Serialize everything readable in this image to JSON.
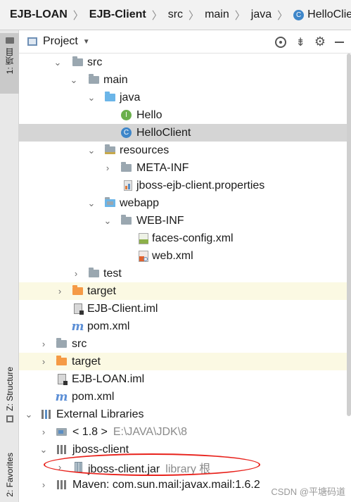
{
  "breadcrumb": [
    "EJB-LOAN",
    "EJB-Client",
    "src",
    "main",
    "java",
    "HelloClient"
  ],
  "left_tabs": {
    "project": "1: 项目",
    "structure": "Z: Structure",
    "favorites": "2: Favorites"
  },
  "panel": {
    "title": "Project"
  },
  "tree": [
    {
      "label": "src",
      "icon": "folder-icon"
    },
    {
      "label": "main",
      "icon": "folder-icon"
    },
    {
      "label": "java",
      "icon": "source-folder-icon"
    },
    {
      "label": "Hello",
      "icon": "interface-icon"
    },
    {
      "label": "HelloClient",
      "icon": "class-icon"
    },
    {
      "label": "resources",
      "icon": "resources-folder-icon"
    },
    {
      "label": "META-INF",
      "icon": "folder-icon"
    },
    {
      "label": "jboss-ejb-client.properties",
      "icon": "properties-file-icon"
    },
    {
      "label": "webapp",
      "icon": "web-folder-icon"
    },
    {
      "label": "WEB-INF",
      "icon": "folder-icon"
    },
    {
      "label": "faces-config.xml",
      "icon": "jsf-file-icon"
    },
    {
      "label": "web.xml",
      "icon": "web-xml-icon"
    },
    {
      "label": "test",
      "icon": "folder-icon"
    },
    {
      "label": "target",
      "icon": "excluded-folder-icon"
    },
    {
      "label": "EJB-Client.iml",
      "icon": "iml-file-icon"
    },
    {
      "label": "pom.xml",
      "icon": "maven-icon"
    },
    {
      "label": "src",
      "icon": "folder-icon"
    },
    {
      "label": "target",
      "icon": "excluded-folder-icon"
    },
    {
      "label": "EJB-LOAN.iml",
      "icon": "iml-file-icon"
    },
    {
      "label": "pom.xml",
      "icon": "maven-icon"
    },
    {
      "label": "External Libraries",
      "icon": "libraries-icon"
    },
    {
      "label": "< 1.8 >",
      "hint": "E:\\JAVA\\JDK\\8",
      "icon": "jdk-icon"
    },
    {
      "label": "jboss-client",
      "icon": "library-icon"
    },
    {
      "label": "jboss-client.jar",
      "hint": "library 根",
      "icon": "jar-icon"
    },
    {
      "label": "Maven: com.sun.mail:javax.mail:1.6.2",
      "icon": "library-icon"
    }
  ],
  "watermark": "CSDN @平塘码道",
  "colors": {
    "selected_row": "#d5d5d5",
    "excluded_row": "#fbf9e3",
    "folder": "#9aa7b0",
    "source_folder": "#6bb5e8",
    "excluded_folder": "#f59a45",
    "annotation": "#e8221c"
  }
}
